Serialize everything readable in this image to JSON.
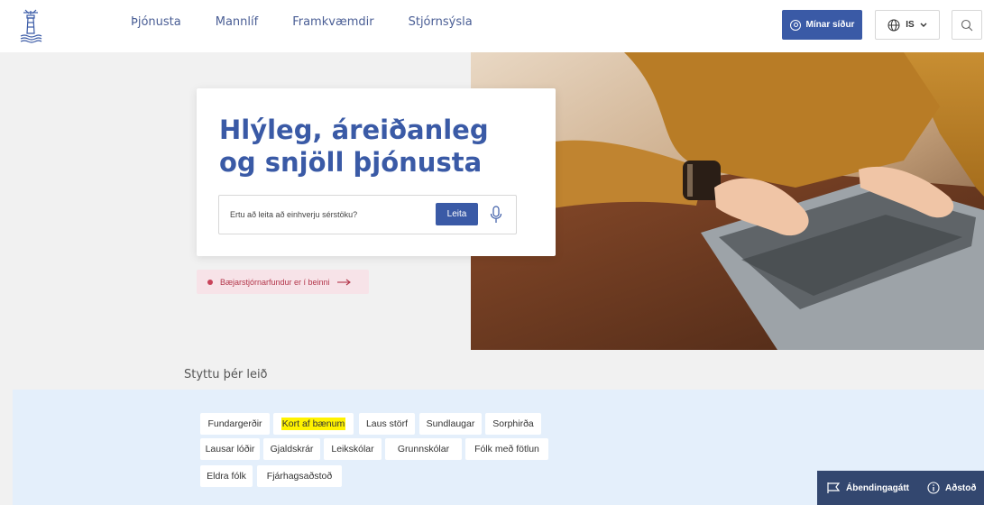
{
  "header": {
    "nav": [
      "Þjónusta",
      "Mannlíf",
      "Framkvæmdir",
      "Stjórnsýsla"
    ],
    "my_pages_label": "Mínar síður",
    "lang_label": "IS"
  },
  "hero": {
    "title_line1": "Hlýleg, áreiðanleg",
    "title_line2": "og snjöll þjónusta",
    "search_placeholder": "Ertu að leita að einhverju sérstöku?",
    "search_button": "Leita",
    "live_notice": "Bæjarstjórnarfundur er í beinni"
  },
  "shortcuts": {
    "title": "Styttu þér leið",
    "chips": [
      "Fundargerðir",
      "Kort af bænum",
      "Laus störf",
      "Sundlaugar",
      "Sorphirða",
      "Lausar lóðir",
      "Gjaldskrár",
      "Leikskólar",
      "Grunnskólar",
      "Fólk með fötlun",
      "Eldra fólk",
      "Fjárhagsaðstoð"
    ],
    "highlighted_chip": "Kort af bænum"
  },
  "footer_bar": {
    "feedback_label": "Ábendingagátt",
    "help_label": "Aðstoð"
  },
  "colors": {
    "brand_blue": "#3a5aa6",
    "chips_bg": "#e4effb",
    "live_pink": "#f7e3e8",
    "highlight": "#fff200",
    "feedback_bar": "#33476f"
  }
}
